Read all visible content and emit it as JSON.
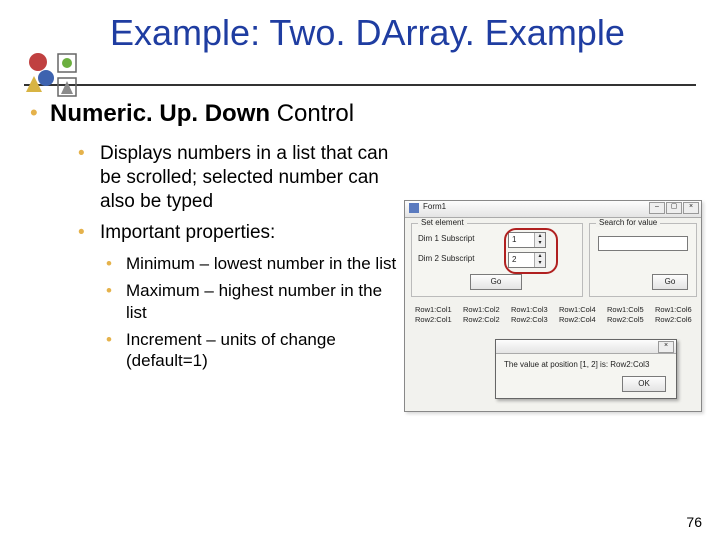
{
  "slide": {
    "title": "Example: Two. DArray. Example",
    "page_number": "76"
  },
  "bullets": {
    "main_bold": "Numeric. Up. Down",
    "main_light": " Control",
    "sub": [
      "Displays numbers in a list that can be scrolled; selected number can also be typed",
      "Important properties:"
    ],
    "props": [
      "Minimum – lowest number in the list",
      "Maximum – highest number in the list",
      "Increment – units of change (default=1)"
    ]
  },
  "form": {
    "window_title": "Form1",
    "group_set": {
      "title": "Set element",
      "row1": "Dim 1 Subscript",
      "row2": "Dim 2 Subscript",
      "val1": "1",
      "val2": "2",
      "go": "Go"
    },
    "group_search": {
      "title": "Search for value",
      "go": "Go"
    },
    "cols": [
      "Row1:Col1",
      "Row1:Col2",
      "Row1:Col3",
      "Row1:Col4",
      "Row1:Col5",
      "Row1:Col6"
    ],
    "cols2": [
      "Row2:Col1",
      "Row2:Col2",
      "Row2:Col3",
      "Row2:Col4",
      "Row2:Col5",
      "Row2:Col6"
    ],
    "msg": {
      "text": "The value at position [1, 2] is: Row2:Col3",
      "ok": "OK"
    }
  }
}
